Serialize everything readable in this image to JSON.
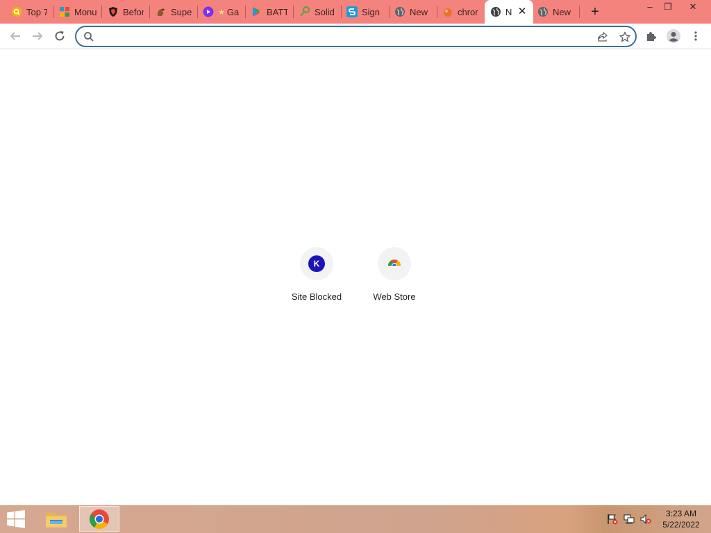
{
  "tabs": [
    {
      "title": "Top 7",
      "icon": "search-icon",
      "color": "#f5b400"
    },
    {
      "title": "Monu",
      "icon": "puzzle-grid-icon",
      "color": "#1f9bd9"
    },
    {
      "title": "Befor",
      "icon": "shield-icon",
      "color": "#1a1a1a"
    },
    {
      "title": "Supe",
      "icon": "squirrel-icon",
      "color": "#8a5a2b"
    },
    {
      "title": "Ga",
      "icon": "play-circle-icon",
      "color": "#7b2ff7"
    },
    {
      "title": "BATT",
      "icon": "play-store-icon",
      "color": "#2f9e44"
    },
    {
      "title": "Solid",
      "icon": "key-icon",
      "color": "#57a33f"
    },
    {
      "title": "Sign",
      "icon": "s-logo-icon",
      "color": "#1f9bd9"
    },
    {
      "title": "New",
      "icon": "globe-icon",
      "color": "#5f6368"
    },
    {
      "title": "chror",
      "icon": "orange-ball-icon",
      "color": "#e8742a"
    },
    {
      "title": "N",
      "icon": "globe-icon",
      "color": "#3c4043",
      "active": true
    },
    {
      "title": "New",
      "icon": "globe-icon",
      "color": "#5f6368"
    }
  ],
  "tab_close_glyph": "✕",
  "newtab_glyph": "+",
  "window_controls": {
    "minimize": "–",
    "restore": "❐",
    "close": "✕"
  },
  "omnibox": {
    "value": "",
    "placeholder": ""
  },
  "shortcuts": [
    {
      "label": "Site Blocked",
      "badge": "K"
    },
    {
      "label": "Web Store",
      "badge": ""
    }
  ],
  "taskbar": {
    "apps": [
      "file-explorer-icon",
      "chrome-icon"
    ],
    "clock": {
      "time": "3:23 AM",
      "date": "5/22/2022"
    }
  },
  "colors": {
    "tabstrip": "#f4837d",
    "omnibox_border": "#3c6e9e",
    "k_badge": "#1b14b8"
  }
}
